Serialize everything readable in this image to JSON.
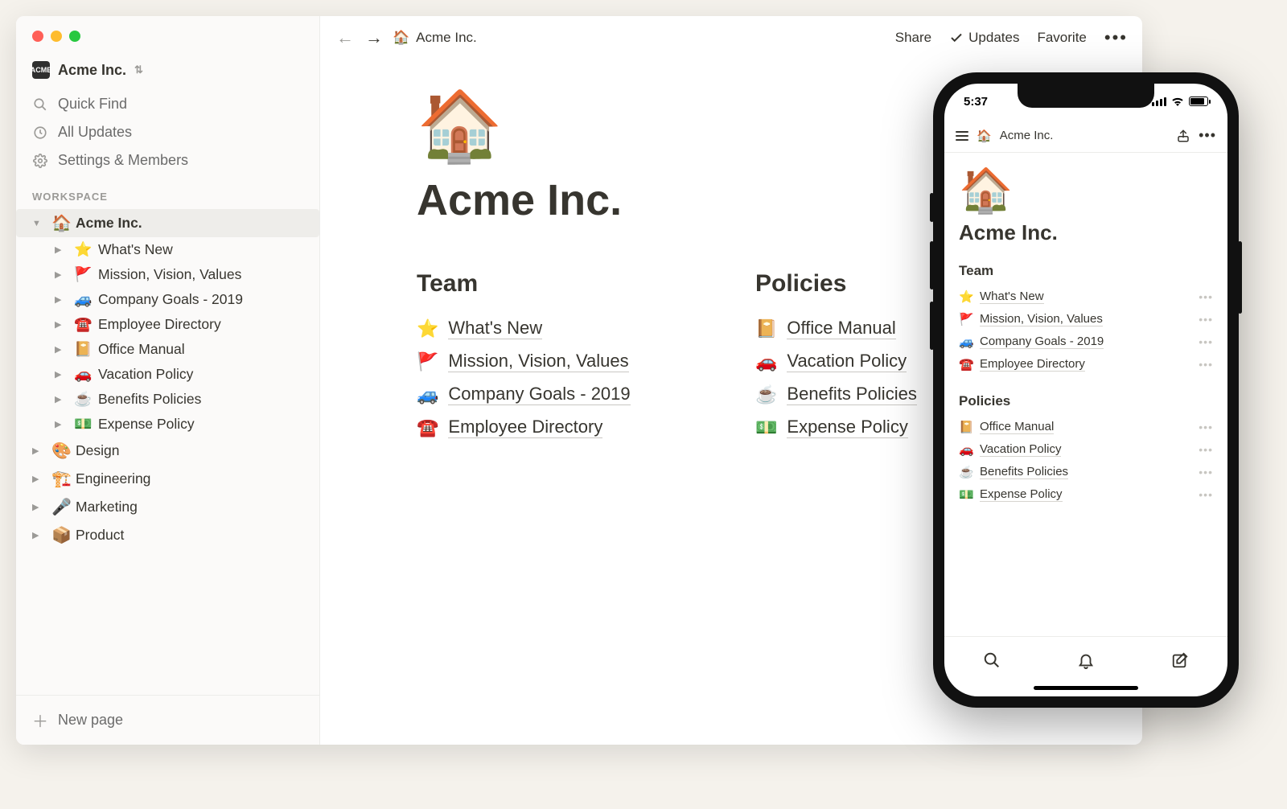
{
  "workspace": {
    "name": "Acme Inc."
  },
  "sidebar": {
    "quick_find": "Quick Find",
    "all_updates": "All Updates",
    "settings": "Settings & Members",
    "section_label": "WORKSPACE",
    "new_page": "New page",
    "tree": {
      "root": {
        "emoji": "🏠",
        "label": "Acme Inc."
      },
      "children": [
        {
          "emoji": "⭐",
          "label": "What's New"
        },
        {
          "emoji": "🚩",
          "label": "Mission, Vision, Values"
        },
        {
          "emoji": "🚙",
          "label": "Company Goals - 2019"
        },
        {
          "emoji": "☎️",
          "label": "Employee Directory"
        },
        {
          "emoji": "📔",
          "label": "Office Manual"
        },
        {
          "emoji": "🚗",
          "label": "Vacation Policy"
        },
        {
          "emoji": "☕",
          "label": "Benefits Policies"
        },
        {
          "emoji": "💵",
          "label": "Expense Policy"
        }
      ],
      "siblings": [
        {
          "emoji": "🎨",
          "label": "Design"
        },
        {
          "emoji": "🏗️",
          "label": "Engineering"
        },
        {
          "emoji": "🎤",
          "label": "Marketing"
        },
        {
          "emoji": "📦",
          "label": "Product"
        }
      ]
    }
  },
  "topbar": {
    "breadcrumb_emoji": "🏠",
    "breadcrumb": "Acme Inc.",
    "share": "Share",
    "updates": "Updates",
    "favorite": "Favorite"
  },
  "page": {
    "icon": "🏠",
    "title": "Acme Inc.",
    "col1_heading": "Team",
    "col2_heading": "Policies",
    "team_links": [
      {
        "emoji": "⭐",
        "label": "What's New"
      },
      {
        "emoji": "🚩",
        "label": "Mission, Vision, Values"
      },
      {
        "emoji": "🚙",
        "label": "Company Goals - 2019"
      },
      {
        "emoji": "☎️",
        "label": "Employee Directory"
      }
    ],
    "policy_links": [
      {
        "emoji": "📔",
        "label": "Office Manual"
      },
      {
        "emoji": "🚗",
        "label": "Vacation Policy"
      },
      {
        "emoji": "☕",
        "label": "Benefits Policies"
      },
      {
        "emoji": "💵",
        "label": "Expense Policy"
      }
    ]
  },
  "mobile": {
    "time": "5:37",
    "breadcrumb_emoji": "🏠",
    "breadcrumb": "Acme Inc.",
    "icon": "🏠",
    "title": "Acme Inc.",
    "team_heading": "Team",
    "policies_heading": "Policies",
    "team_links": [
      {
        "emoji": "⭐",
        "label": "What's New"
      },
      {
        "emoji": "🚩",
        "label": "Mission, Vision, Values"
      },
      {
        "emoji": "🚙",
        "label": "Company Goals - 2019"
      },
      {
        "emoji": "☎️",
        "label": "Employee Directory"
      }
    ],
    "policy_links": [
      {
        "emoji": "📔",
        "label": "Office Manual"
      },
      {
        "emoji": "🚗",
        "label": "Vacation Policy"
      },
      {
        "emoji": "☕",
        "label": "Benefits Policies"
      },
      {
        "emoji": "💵",
        "label": "Expense Policy"
      }
    ]
  }
}
